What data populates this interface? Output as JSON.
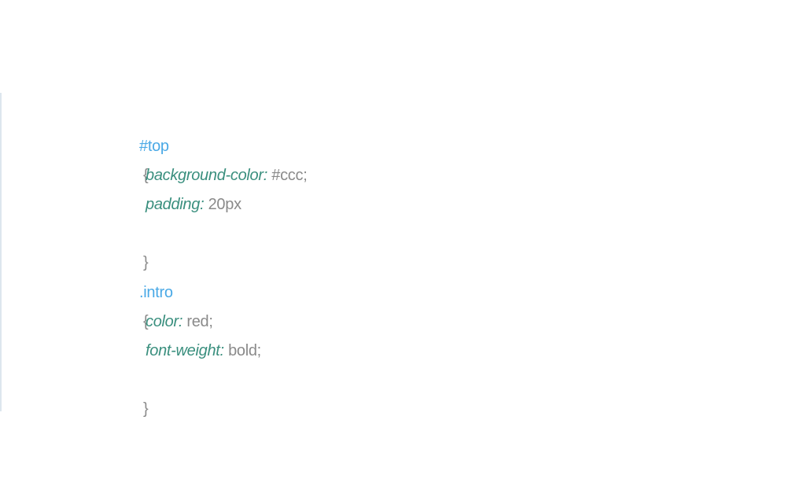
{
  "colors": {
    "selector": "#4aa9e6",
    "property": "#3a8f7e",
    "value": "#8a8a8a",
    "brace": "#8a8a8a",
    "background": "#ffffff"
  },
  "code": {
    "rule1": {
      "selector": "#top",
      "open": "{",
      "decl1": {
        "property": "background-color:",
        "value": "#ccc;"
      },
      "decl2": {
        "property": "padding:",
        "value": "20px"
      },
      "close": "}"
    },
    "rule2": {
      "selector": ".intro",
      "open": "{",
      "decl1": {
        "property": "color:",
        "value": "red;"
      },
      "decl2": {
        "property": "font-weight:",
        "value": "bold;"
      },
      "close": "}"
    }
  }
}
